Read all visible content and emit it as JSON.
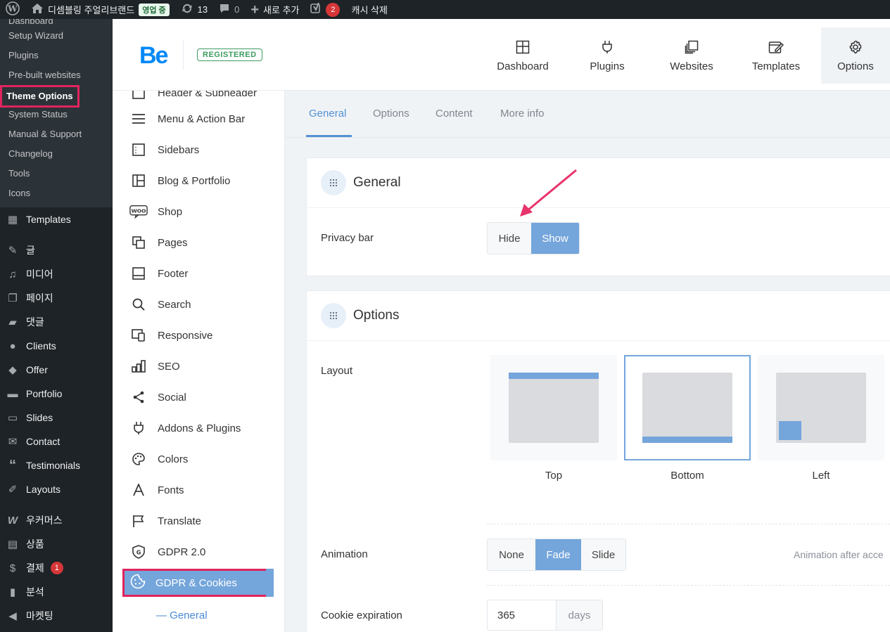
{
  "adminbar": {
    "site_name": "디셈블링 주얼리브랜드",
    "status": "영업 중",
    "updates_count": "13",
    "comments_count": "0",
    "new_label": "새로 추가",
    "yoast_count": "2",
    "cache_label": "캐시 삭제",
    "icons": [
      "wordpress-icon",
      "home-icon",
      "updates-icon",
      "comment-icon",
      "plus-icon",
      "yoast-icon"
    ]
  },
  "wp_menu": {
    "submenu": [
      "Dashboard",
      "Setup Wizard",
      "Plugins",
      "Pre-built websites",
      "Theme Options",
      "System Status",
      "Manual & Support",
      "Changelog",
      "Tools",
      "Icons"
    ],
    "current_sub": "Theme Options",
    "items": [
      {
        "label": "Templates",
        "icon": "templates-icon"
      },
      {
        "label": "글",
        "icon": "pin-icon"
      },
      {
        "label": "미디어",
        "icon": "media-icon"
      },
      {
        "label": "페이지",
        "icon": "page-icon"
      },
      {
        "label": "댓글",
        "icon": "comment-icon"
      },
      {
        "label": "Clients",
        "icon": "clients-icon"
      },
      {
        "label": "Offer",
        "icon": "tag-icon"
      },
      {
        "label": "Portfolio",
        "icon": "folder-icon"
      },
      {
        "label": "Slides",
        "icon": "slides-icon"
      },
      {
        "label": "Contact",
        "icon": "mail-icon"
      },
      {
        "label": "Testimonials",
        "icon": "quote-icon"
      },
      {
        "label": "Layouts",
        "icon": "brush-icon"
      },
      {
        "label": "우커머스",
        "icon": "woo-icon"
      },
      {
        "label": "상품",
        "icon": "archive-icon"
      },
      {
        "label": "결제",
        "icon": "payment-icon",
        "badge": "1"
      },
      {
        "label": "분석",
        "icon": "chart-icon"
      },
      {
        "label": "마켓팅",
        "icon": "megaphone-icon"
      }
    ]
  },
  "be": {
    "logo": "Be",
    "registered": "REGISTERED",
    "nav": [
      {
        "label": "Dashboard",
        "icon": "dashboard-icon"
      },
      {
        "label": "Plugins",
        "icon": "plug-icon"
      },
      {
        "label": "Websites",
        "icon": "websites-icon"
      },
      {
        "label": "Templates",
        "icon": "templates-edit-icon"
      },
      {
        "label": "Options",
        "icon": "gear-icon"
      }
    ],
    "active_nav": "Options"
  },
  "options_sidebar": {
    "items": [
      {
        "label": "Header & Subheader",
        "icon": "header-icon"
      },
      {
        "label": "Menu & Action Bar",
        "icon": "menu-icon"
      },
      {
        "label": "Sidebars",
        "icon": "sidebar-icon"
      },
      {
        "label": "Blog & Portfolio",
        "icon": "grid-icon"
      },
      {
        "label": "Shop",
        "icon": "woo-icon"
      },
      {
        "label": "Pages",
        "icon": "pages-icon"
      },
      {
        "label": "Footer",
        "icon": "footer-icon"
      },
      {
        "label": "Search",
        "icon": "search-icon"
      },
      {
        "label": "Responsive",
        "icon": "responsive-icon"
      },
      {
        "label": "SEO",
        "icon": "seo-icon"
      },
      {
        "label": "Social",
        "icon": "share-icon"
      },
      {
        "label": "Addons & Plugins",
        "icon": "plug-icon"
      },
      {
        "label": "Colors",
        "icon": "palette-icon"
      },
      {
        "label": "Fonts",
        "icon": "font-icon"
      },
      {
        "label": "Translate",
        "icon": "flag-icon"
      },
      {
        "label": "GDPR 2.0",
        "icon": "gdpr-shield-icon"
      }
    ],
    "active": {
      "label": "GDPR & Cookies",
      "icon": "cookie-icon"
    },
    "sub_active": "General"
  },
  "tabs": [
    "General",
    "Options",
    "Content",
    "More info"
  ],
  "active_tab": "General",
  "general": {
    "title": "General",
    "privacy_bar": {
      "label": "Privacy bar",
      "options": [
        "Hide",
        "Show"
      ],
      "selected": "Show"
    }
  },
  "options": {
    "title": "Options",
    "layout": {
      "label": "Layout",
      "options": [
        "Top",
        "Bottom",
        "Left"
      ],
      "selected": "Bottom"
    },
    "animation": {
      "label": "Animation",
      "options": [
        "None",
        "Fade",
        "Slide"
      ],
      "selected": "Fade",
      "description": "Animation after acce"
    },
    "cookie_expiration": {
      "label": "Cookie expiration",
      "value": "365",
      "unit": "days"
    }
  },
  "colors": {
    "accent": "#74a5db",
    "highlight": "#e0245e",
    "brand": "#0089f7",
    "admin_bg": "#1d2327"
  }
}
